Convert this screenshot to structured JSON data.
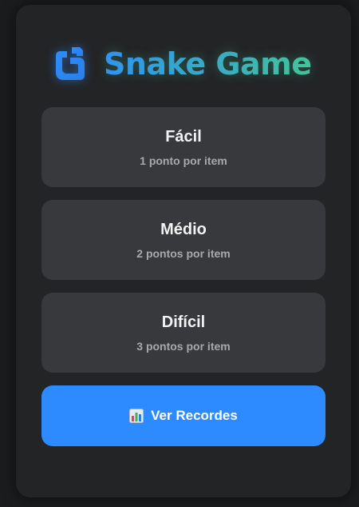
{
  "app": {
    "title": "Snake Game",
    "logo_icon": "snake-icon"
  },
  "modes": [
    {
      "label": "Fácil",
      "description": "1 ponto por item"
    },
    {
      "label": "Médio",
      "description": "2 pontos por item"
    },
    {
      "label": "Difícil",
      "description": "3 pontos por item"
    }
  ],
  "records_button": {
    "icon": "bar-chart-icon",
    "label": "Ver Recordes"
  },
  "colors": {
    "background": "#1b1c1e",
    "card": "#232426",
    "mode_button": "#38393c",
    "accent_blue": "#2e8bff",
    "accent_green": "#43c59a"
  }
}
